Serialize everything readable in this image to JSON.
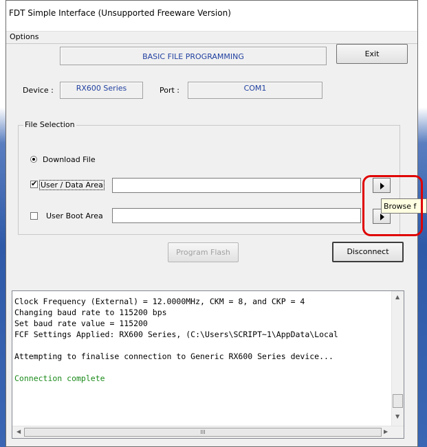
{
  "window": {
    "title": "FDT Simple Interface   (Unsupported Freeware Version)"
  },
  "menu": {
    "options": "Options"
  },
  "header": {
    "mode_label": "BASIC FILE PROGRAMMING",
    "exit_button": "Exit"
  },
  "device": {
    "device_label": "Device :",
    "device_value": "RX600 Series",
    "port_label": "Port :",
    "port_value": "COM1"
  },
  "file_selection": {
    "group_label": "File Selection",
    "download_radio": {
      "label": "Download File",
      "selected": true
    },
    "user_data_checkbox": {
      "label": "User / Data Area",
      "checked": true,
      "path": ""
    },
    "user_boot_checkbox": {
      "label": "User Boot Area",
      "checked": false,
      "path": ""
    },
    "browse_icon": "play-triangle-icon"
  },
  "actions": {
    "program_flash": "Program Flash",
    "disconnect": "Disconnect"
  },
  "tooltip": {
    "text": "Browse f"
  },
  "log": {
    "lines": [
      "Clock Frequency (External) = 12.0000MHz, CKM = 8, and CKP = 4",
      "Changing baud rate to 115200 bps",
      "Set baud rate value = 115200",
      "FCF Settings Applied: RX600 Series, (C:\\Users\\SCRIPT~1\\AppData\\Local",
      "",
      "Attempting to finalise connection to Generic RX600 Series device...",
      "",
      "Connection complete"
    ],
    "success_color": "#1a8a1a",
    "hscroll_thumb_glyph": "III"
  },
  "colors": {
    "highlight": "#e00000",
    "accent_blue": "#1f3f9f"
  }
}
